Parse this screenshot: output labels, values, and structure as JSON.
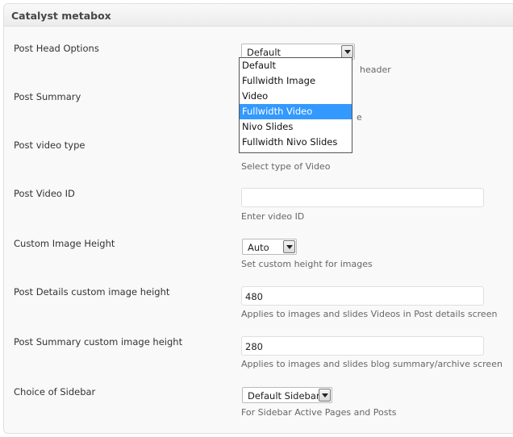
{
  "metabox": {
    "title": "Catalyst metabox"
  },
  "rows": {
    "post_head_options": {
      "label": "Post Head Options",
      "value": "Default",
      "desc_partial": "header",
      "dropdown_options": [
        "Default",
        "Fullwidth Image",
        "Video",
        "Fullwidth Video",
        "Nivo Slides",
        "Fullwidth Nivo Slides"
      ],
      "highlighted_option": "Fullwidth Video"
    },
    "post_summary": {
      "label": "Post Summary",
      "desc_partial": "e"
    },
    "post_video_type": {
      "label": "Post video type",
      "desc": "Select type of Video"
    },
    "post_video_id": {
      "label": "Post Video ID",
      "value": "",
      "desc": "Enter video ID"
    },
    "custom_image_height": {
      "label": "Custom Image Height",
      "value": "Auto",
      "desc": "Set custom height for images"
    },
    "post_details_height": {
      "label": "Post Details custom image height",
      "value": "480",
      "desc": "Applies to images and slides Videos in Post details screen"
    },
    "post_summary_height": {
      "label": "Post Summary custom image height",
      "value": "280",
      "desc": "Applies to images and slides blog summary/archive screen"
    },
    "choice_of_sidebar": {
      "label": "Choice of Sidebar",
      "value": "Default Sidebar",
      "desc": "For Sidebar Active Pages and Posts"
    }
  },
  "colors": {
    "highlight": "#3399ff",
    "header_bg": "#ececec",
    "box_bg": "#f9f9f9"
  }
}
